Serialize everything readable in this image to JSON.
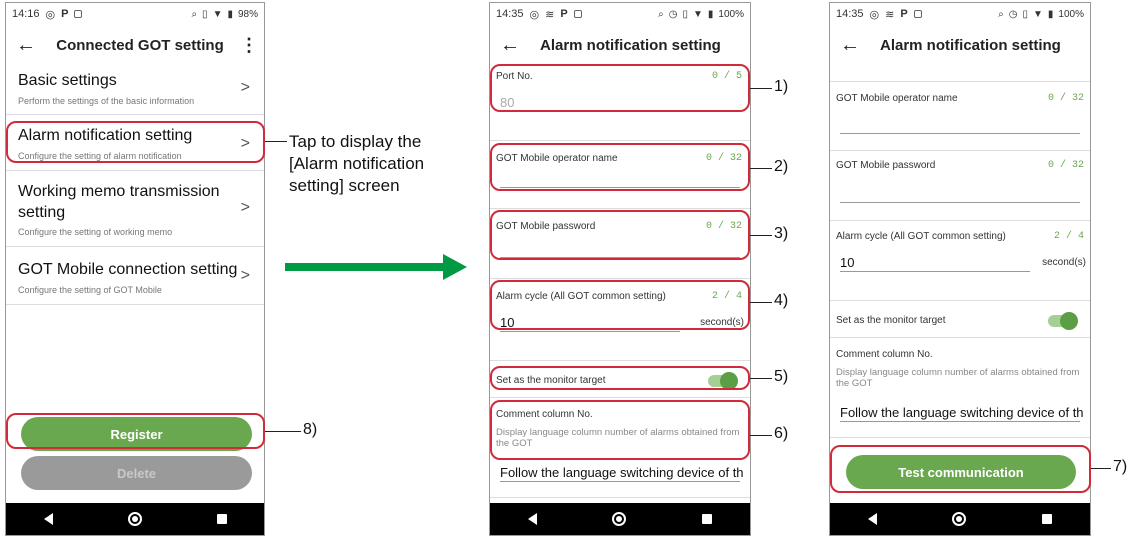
{
  "phone1": {
    "status": {
      "time": "14:16",
      "battery": "98%"
    },
    "title": "Connected GOT setting",
    "menu": [
      {
        "title": "Basic settings",
        "subtitle": "Perform the settings of the basic information"
      },
      {
        "title": "Alarm notification setting",
        "subtitle": "Configure the setting of alarm notification"
      },
      {
        "title": "Working memo transmission setting",
        "subtitle": "Configure the setting of working memo"
      },
      {
        "title": "GOT Mobile connection setting",
        "subtitle": "Configure the setting of GOT Mobile"
      }
    ],
    "register_label": "Register",
    "delete_label": "Delete"
  },
  "annotation_text": "Tap to display the [Alarm notification setting] screen",
  "annotation_lines": [
    "Tap to display the",
    "[Alarm notification",
    "setting] screen"
  ],
  "phone2": {
    "status": {
      "time": "14:35",
      "battery": "100%"
    },
    "title": "Alarm notification setting",
    "port": {
      "label": "Port No.",
      "counter": "0 / 5",
      "placeholder": "80"
    },
    "operator": {
      "label": "GOT Mobile operator name",
      "counter": "0 / 32"
    },
    "password": {
      "label": "GOT Mobile password",
      "counter": "0 / 32"
    },
    "cycle": {
      "label": "Alarm cycle (All GOT common setting)",
      "counter": "2 / 4",
      "value": "10",
      "unit": "second(s)"
    },
    "monitor": {
      "label": "Set as the monitor target",
      "on": true
    },
    "comment": {
      "label": "Comment column No.",
      "desc": "Display language column number of alarms obtained from the GOT",
      "value": "Follow the language switching device of th"
    }
  },
  "phone3": {
    "status": {
      "time": "14:35",
      "battery": "100%"
    },
    "title": "Alarm notification setting",
    "operator": {
      "label": "GOT Mobile operator name",
      "counter": "0 / 32"
    },
    "password": {
      "label": "GOT Mobile password",
      "counter": "0 / 32"
    },
    "cycle": {
      "label": "Alarm cycle (All GOT common setting)",
      "counter": "2 / 4",
      "value": "10",
      "unit": "second(s)"
    },
    "monitor": {
      "label": "Set as the monitor target",
      "on": true
    },
    "comment": {
      "label": "Comment column No.",
      "desc": "Display language column number of alarms obtained from the GOT",
      "value": "Follow the language switching device of th"
    },
    "test_label": "Test communication"
  },
  "callouts": [
    "1)",
    "2)",
    "3)",
    "4)",
    "5)",
    "6)",
    "7)",
    "8)"
  ],
  "colors": {
    "accent_green": "#6aa84f",
    "highlight_red": "#d12b3a",
    "arrow_green": "#009a44"
  }
}
